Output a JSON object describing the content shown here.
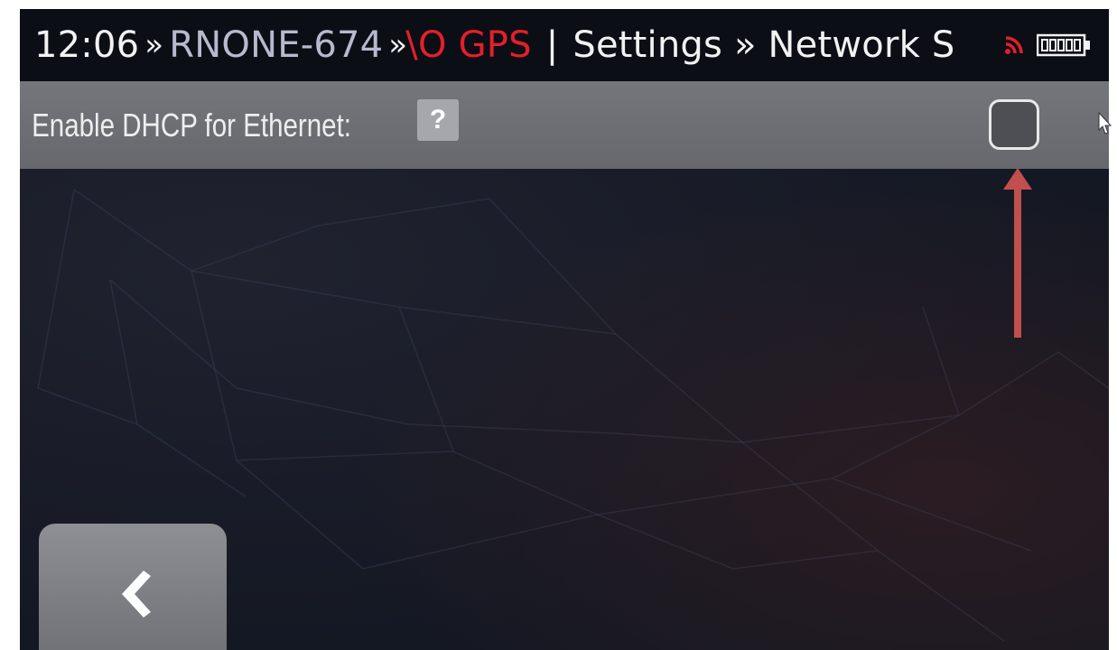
{
  "status_bar": {
    "time": "12:06",
    "separator_1": "»",
    "device_id": "RNONE-674",
    "separator_2": "»",
    "gps_status": "\\O GPS",
    "divider": "|",
    "breadcrumb": "Settings » Network S",
    "icons": [
      "wifi-signal-icon",
      "battery-icon"
    ]
  },
  "setting": {
    "label": "Enable DHCP for Ethernet:",
    "help_label": "?",
    "checked": false
  },
  "back_button": {
    "label": "❮"
  },
  "colors": {
    "status_bar_bg": "#0b0e15",
    "gps_alert": "#e51f2a",
    "device_text": "#b9b9ce",
    "annotation_arrow": "#c0504d",
    "row_bg": "#6c6e74"
  }
}
